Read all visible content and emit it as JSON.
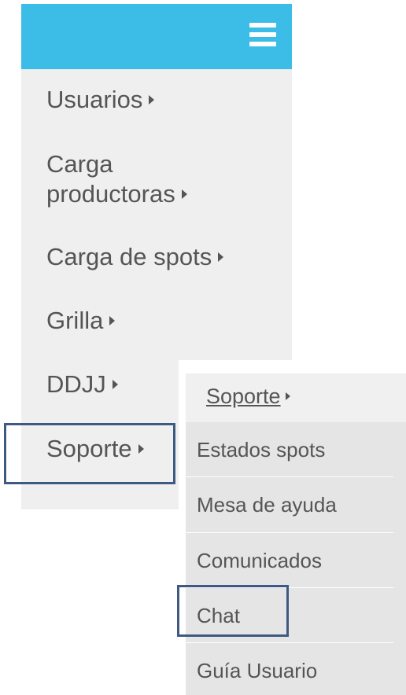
{
  "menu": {
    "items": [
      {
        "label": "Usuarios"
      },
      {
        "label_line1": "Carga",
        "label_line2": "productoras"
      },
      {
        "label": "Carga de spots"
      },
      {
        "label": "Grilla"
      },
      {
        "label": "DDJJ"
      },
      {
        "label": "Soporte"
      }
    ]
  },
  "submenu": {
    "title": "Soporte",
    "items": [
      {
        "label": "Estados spots"
      },
      {
        "label": "Mesa de ayuda"
      },
      {
        "label": "Comunicados"
      },
      {
        "label": "Chat"
      },
      {
        "label": "Guía Usuario"
      }
    ]
  },
  "colors": {
    "topbar": "#3cbde8",
    "highlight_border": "#3e5a82",
    "menu_bg": "#efefef",
    "submenu_bg": "#e5e5e5",
    "text": "#555555"
  },
  "icons": {
    "menu_toggle": "hamburger-icon",
    "submenu_indicator": "caret-right-icon"
  }
}
